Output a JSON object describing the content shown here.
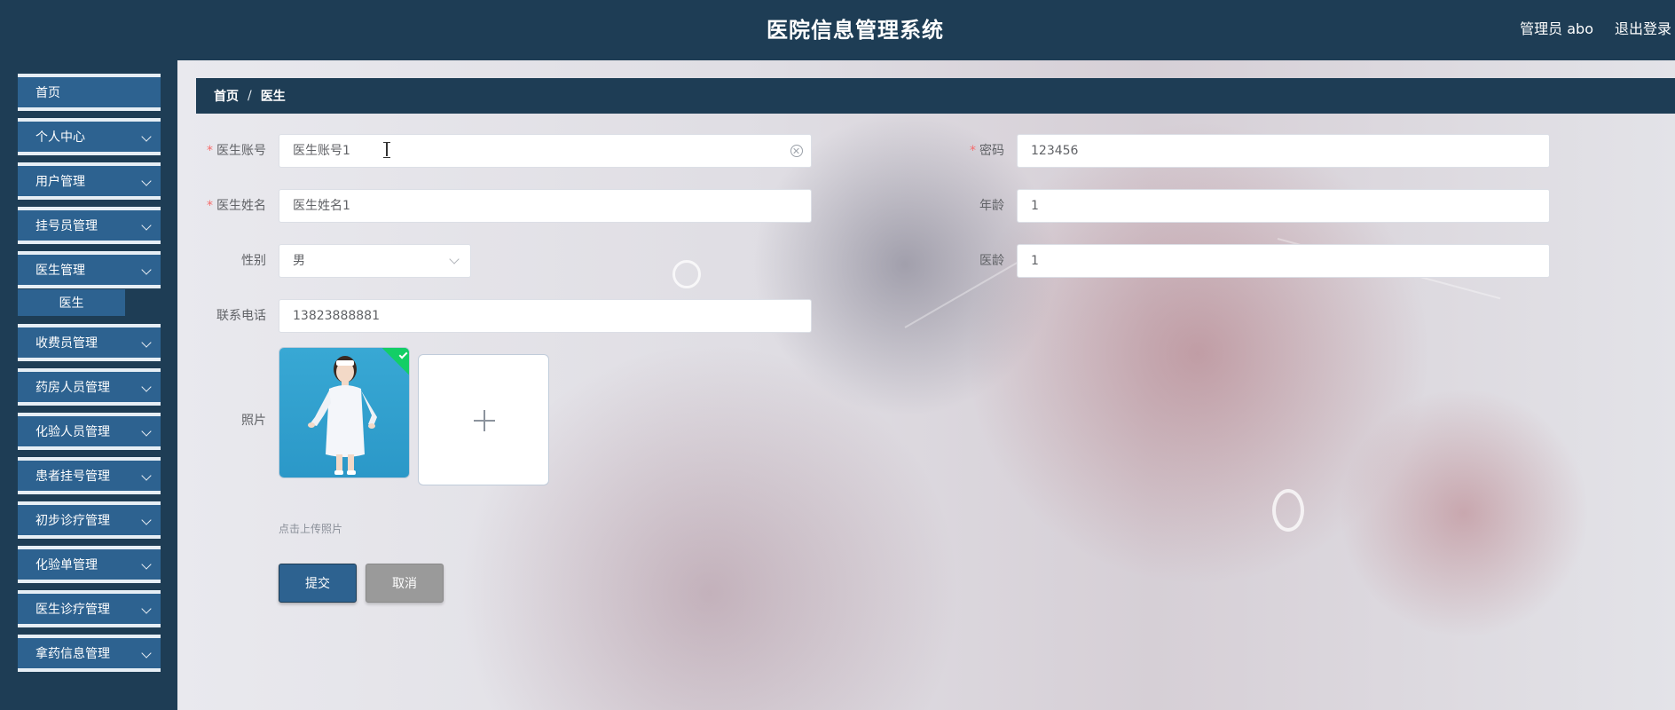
{
  "header": {
    "title": "医院信息管理系统",
    "user_label": "管理员 abo",
    "logout_label": "退出登录"
  },
  "sidebar": {
    "items": [
      {
        "label": "首页",
        "has_children": false
      },
      {
        "label": "个人中心",
        "has_children": true
      },
      {
        "label": "用户管理",
        "has_children": true
      },
      {
        "label": "挂号员管理",
        "has_children": true
      },
      {
        "label": "医生管理",
        "has_children": true,
        "expanded": true
      },
      {
        "label": "收费员管理",
        "has_children": true
      },
      {
        "label": "药房人员管理",
        "has_children": true
      },
      {
        "label": "化验人员管理",
        "has_children": true
      },
      {
        "label": "患者挂号管理",
        "has_children": true
      },
      {
        "label": "初步诊疗管理",
        "has_children": true
      },
      {
        "label": "化验单管理",
        "has_children": true
      },
      {
        "label": "医生诊疗管理",
        "has_children": true
      },
      {
        "label": "拿药信息管理",
        "has_children": true
      }
    ],
    "submenu": {
      "label": "医生"
    }
  },
  "breadcrumb": {
    "home": "首页",
    "separator": "/",
    "current": "医生"
  },
  "form": {
    "doctor_account": {
      "label": "医生账号",
      "value": "医生账号1",
      "required": true
    },
    "password": {
      "label": "密码",
      "value": "123456",
      "required": true
    },
    "doctor_name": {
      "label": "医生姓名",
      "value": "医生姓名1",
      "required": true
    },
    "age": {
      "label": "年龄",
      "value": "1"
    },
    "gender": {
      "label": "性别",
      "value": "男"
    },
    "seniority": {
      "label": "医龄",
      "value": "1"
    },
    "phone": {
      "label": "联系电话",
      "value": "13823888881"
    },
    "photo": {
      "label": "照片",
      "hint": "点击上传照片",
      "uploaded": true
    }
  },
  "actions": {
    "submit_label": "提交",
    "cancel_label": "取消"
  },
  "colors": {
    "header_bg": "#1e3d55",
    "menu_bg": "#2d6290",
    "required": "#f56c6c",
    "upload_success": "#13ce66"
  }
}
